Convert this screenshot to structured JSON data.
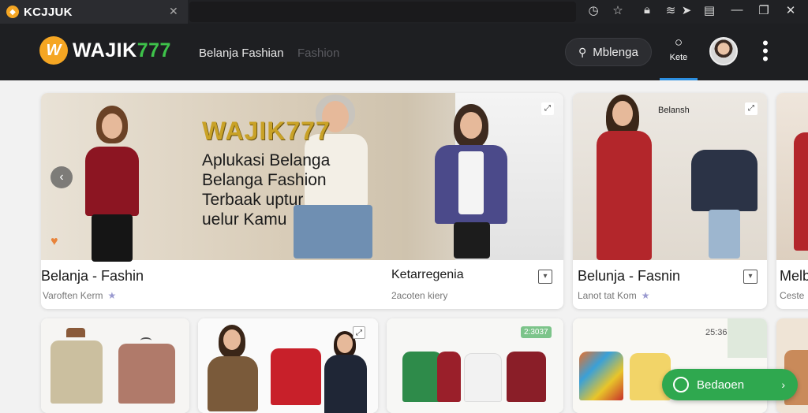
{
  "window": {
    "tab_title": "KCJJUK",
    "tab_logo": "shield-logo",
    "tab_close": "✕"
  },
  "header": {
    "brand_part1": "WAJIK",
    "brand_part2": "777",
    "nav_item_1": "Belanja Fashian",
    "nav_item_2": "Fashion",
    "search_label": "Mblenga",
    "search_icon": "search-icon",
    "nav_active_label": "Kete",
    "kebab": "⋮",
    "accent_color": "#2d8fe0"
  },
  "hero": {
    "brand_tag": "WAJIK777",
    "line1": "Aplukasi Belanga",
    "line2": "Belanga Fashion",
    "line3": "Terbaak uptur",
    "line4": "uelur Kamu",
    "prev": "‹",
    "title": "Belanja - Fashin",
    "subtitle": "Varoften Kerm",
    "mid_title": "Ketarregenia",
    "mid_subtitle": "2acoten kiery"
  },
  "card2": {
    "corner_label": "Belansh",
    "title": "Belunja - Fasnin",
    "subtitle": "Lanot tat Kom"
  },
  "card3": {
    "title": "Melb",
    "subtitle": "Ceste"
  },
  "row2": {
    "price_1": "2:3037",
    "price_2": "25:36"
  },
  "fab": {
    "label": "Bedaoen",
    "color": "#2fa84f"
  }
}
